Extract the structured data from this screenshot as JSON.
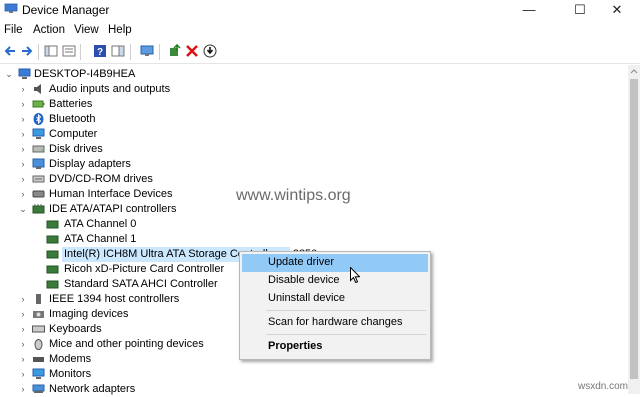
{
  "window": {
    "title": "Device Manager",
    "minimize": "—",
    "maximize": "☐",
    "close": "✕"
  },
  "menu": [
    "File",
    "Action",
    "View",
    "Help"
  ],
  "toolbar": {
    "icons": [
      "back-arrow-icon",
      "forward-arrow-icon",
      "show-hide-tree-icon",
      "properties-icon",
      "help-icon",
      "action-pane-icon",
      "scan-hardware-icon",
      "update-driver-icon",
      "uninstall-icon",
      "disable-icon"
    ]
  },
  "tree": {
    "root": "DESKTOP-I4B9HEA",
    "categories": [
      "Audio inputs and outputs",
      "Batteries",
      "Bluetooth",
      "Computer",
      "Disk drives",
      "Display adapters",
      "DVD/CD-ROM drives",
      "Human Interface Devices",
      "IDE ATA/ATAPI controllers"
    ],
    "ide_children": [
      "ATA Channel 0",
      "ATA Channel 1",
      "Intel(R) ICH8M Ultra ATA Storage Controllers - 2850",
      "Ricoh xD-Picture Card Controller",
      "Standard SATA AHCI Controller"
    ],
    "more_categories": [
      "IEEE 1394 host controllers",
      "Imaging devices",
      "Keyboards",
      "Mice and other pointing devices",
      "Modems",
      "Monitors",
      "Network adapters"
    ]
  },
  "context_menu": {
    "items": [
      "Update driver",
      "Disable device",
      "Uninstall device",
      "Scan for hardware changes",
      "Properties"
    ]
  },
  "watermark": "www.wintips.org",
  "corner_watermark": "wsxdn.com"
}
